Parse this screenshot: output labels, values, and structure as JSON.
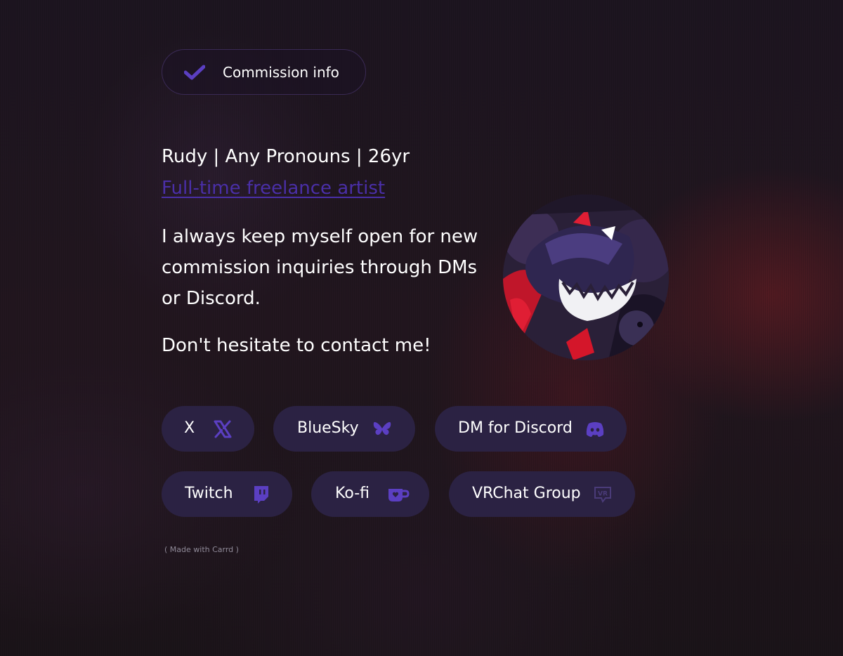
{
  "commission": {
    "label": "Commission info",
    "icon": "checkmark-icon"
  },
  "profile": {
    "headline": "Rudy | Any Pronouns | 26yr",
    "subtitle": "Full-time freelance artist",
    "description": "I always keep myself open for new commission inquiries through DMs or Discord.",
    "cta": "Don't hesitate to contact me!"
  },
  "links": [
    {
      "label": "X",
      "icon": "x-logo-icon"
    },
    {
      "label": "BlueSky",
      "icon": "butterfly-icon"
    },
    {
      "label": "DM for Discord",
      "icon": "discord-icon"
    },
    {
      "label": "Twitch",
      "icon": "twitch-icon"
    },
    {
      "label": "Ko-fi",
      "icon": "kofi-cup-icon"
    },
    {
      "label": "VRChat Group",
      "icon": "vrchat-icon"
    }
  ],
  "footer": {
    "made_with": "( Made with Carrd )"
  },
  "colors": {
    "accent": "#4a2fa8",
    "button_bg": "#2b2243",
    "icon": "#5b3fc2",
    "text": "#ffffff"
  }
}
